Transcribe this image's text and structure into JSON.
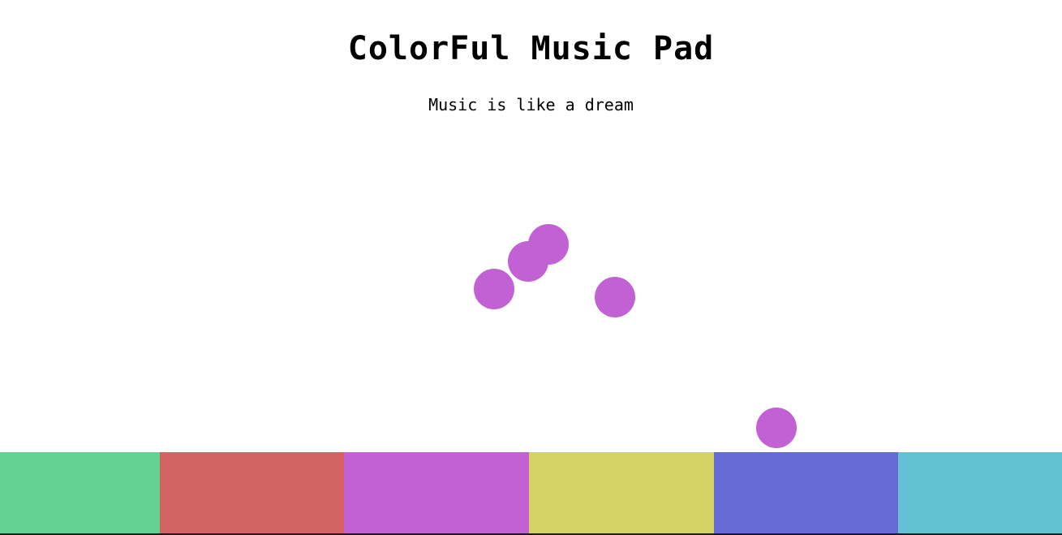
{
  "header": {
    "title": "ColorFul Music Pad",
    "subtitle": "Music is like a dream"
  },
  "bubble_color": "#c261d4",
  "pads": [
    {
      "name": "pad-green",
      "color": "#63d394"
    },
    {
      "name": "pad-red",
      "color": "#d36262"
    },
    {
      "name": "pad-purple",
      "color": "#c261d4"
    },
    {
      "name": "pad-yellow",
      "color": "#d4d262"
    },
    {
      "name": "pad-blue",
      "color": "#666cd4"
    },
    {
      "name": "pad-cyan",
      "color": "#63c1d3"
    }
  ]
}
